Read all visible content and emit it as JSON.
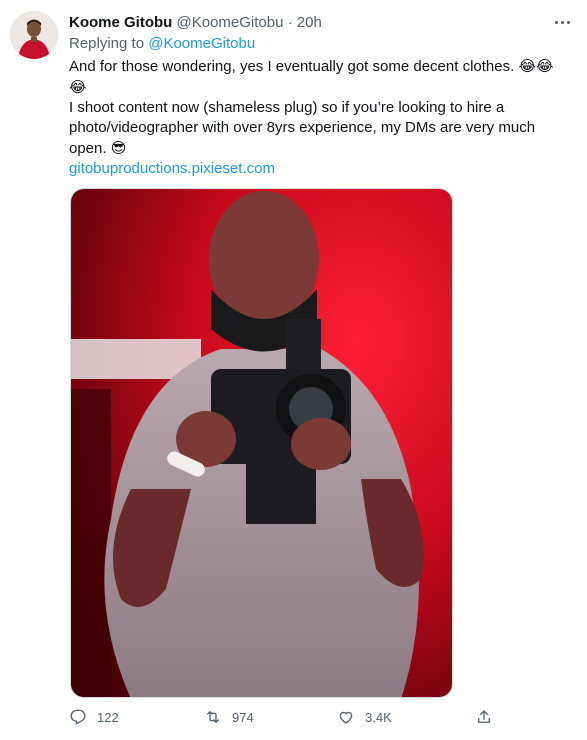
{
  "tweet": {
    "author_name": "Koome Gitobu",
    "author_handle": "@KoomeGitobu",
    "separator": "·",
    "time": "20h",
    "replying_prefix": "Replying to",
    "replying_handle": "@KoomeGitobu",
    "line1": "And for those wondering, yes I eventually got some decent clothes.",
    "line1_emoji": "😂😂",
    "line1_emoji_wrap": "😂",
    "line2": "I shoot content now (shameless plug) so if you’re looking to hire a photo/videographer with over 8yrs experience, my DMs are very much open.",
    "line2_emoji": "😎",
    "link": "gitobuproductions.pixieset.com"
  },
  "actions": {
    "replies": "122",
    "retweets": "974",
    "likes": "3.4K"
  },
  "icons": {
    "more": "more-icon",
    "reply": "reply-icon",
    "retweet": "retweet-icon",
    "like": "heart-icon",
    "share": "share-icon"
  },
  "colors": {
    "accent": "#1d9bf0",
    "muted": "#536471",
    "photo_light": "#e0162b"
  }
}
